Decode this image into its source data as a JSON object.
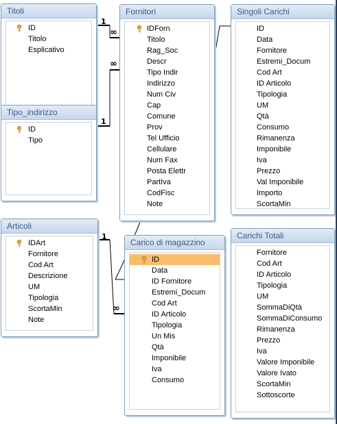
{
  "tables": {
    "titoli": {
      "title": "Titoli",
      "fields": [
        "ID",
        "Titolo",
        "Esplicativo"
      ],
      "key_field": "ID"
    },
    "tipo_indirizzo": {
      "title": "Tipo_indirizzo",
      "fields": [
        "ID",
        "Tipo"
      ],
      "key_field": "ID"
    },
    "articoli": {
      "title": "Articoli",
      "fields": [
        "IDArt",
        "Fornitore",
        "Cod Art",
        "Descrizione",
        "UM",
        "Tipologia",
        "ScortaMin",
        "Note"
      ],
      "key_field": "IDArt"
    },
    "fornitori": {
      "title": "Fornitori",
      "fields": [
        "IDForn",
        "Titolo",
        "Rag_Soc",
        "Descr",
        "Tipo Indir",
        "Indirizzo",
        "Num Civ",
        "Cap",
        "Comune",
        "Prov",
        "Tel Ufficio",
        "Cellulare",
        "Num Fax",
        "Posta Elettr",
        "PartIva",
        "CodFisc",
        "Note"
      ],
      "key_field": "IDForn"
    },
    "carico": {
      "title": "Carico di magazzino",
      "fields": [
        "ID",
        "Data",
        "ID Fornitore",
        "Estremi_Docum",
        "Cod Art",
        "ID Articolo",
        "Tipologia",
        "Un Mis",
        "Qtà",
        "Imponibile",
        "Iva",
        "Consumo"
      ],
      "key_field": "ID",
      "selected_field": "ID"
    },
    "singoli_carichi": {
      "title": "Singoli Carichi",
      "fields": [
        "ID",
        "Data",
        "Fornitore",
        "Estremi_Docum",
        "Cod Art",
        "ID Articolo",
        "Tipologia",
        "UM",
        "Qtà",
        "Consumo",
        "Rimanenza",
        "Imponibile",
        "Iva",
        "Prezzo",
        "Val Imponibile",
        "Importo",
        "ScortaMin"
      ]
    },
    "carichi_totali": {
      "title": "Carichi Totali",
      "fields": [
        "Fornitore",
        "Cod Art",
        "ID Articolo",
        "Tipologia",
        "UM",
        "SommaDiQtà",
        "SommaDiConsumo",
        "Rimanenza",
        "Prezzo",
        "Iva",
        "Valore Imponibile",
        "Valore Ivato",
        "ScortaMin",
        "Sottoscorte"
      ]
    }
  },
  "relationships": [
    {
      "from": "Titoli.ID",
      "to": "Fornitori.Titolo",
      "one": "1",
      "many": "∞"
    },
    {
      "from": "Tipo_indirizzo.ID",
      "to": "Fornitori.Tipo Indir",
      "one": "1",
      "many": "∞"
    },
    {
      "from": "Articoli.IDArt",
      "to": "Carico di magazzino.ID Articolo",
      "one": "1",
      "many": "∞"
    }
  ],
  "icons": {
    "primary_key": "key-icon"
  },
  "colors": {
    "header_text": "#3c5a86",
    "selected_row": "#f8bc6b",
    "border": "#7f9db9"
  }
}
